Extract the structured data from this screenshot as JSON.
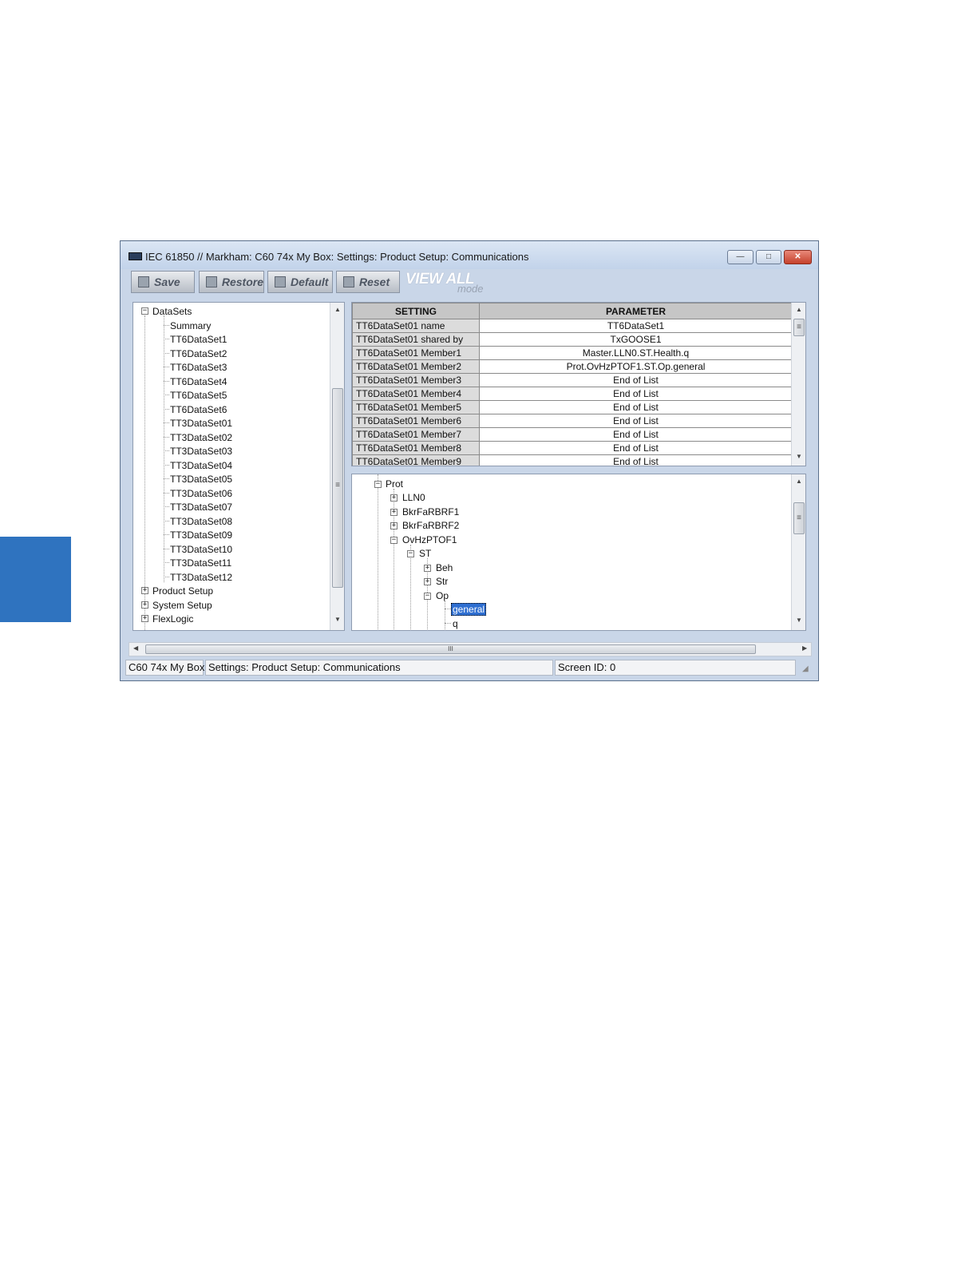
{
  "window": {
    "title": "IEC 61850 // Markham: C60 74x My Box: Settings: Product Setup: Communications",
    "minimize": "—",
    "restore": "□",
    "close": "✕"
  },
  "toolbar": {
    "save_label": "Save",
    "restore_label": "Restore",
    "default_label": "Default",
    "reset_label": "Reset",
    "view_all_label": "VIEW ALL",
    "mode_label": "mode"
  },
  "left_tree": {
    "root": "DataSets",
    "children": [
      "Summary",
      "TT6DataSet1",
      "TT6DataSet2",
      "TT6DataSet3",
      "TT6DataSet4",
      "TT6DataSet5",
      "TT6DataSet6",
      "TT3DataSet01",
      "TT3DataSet02",
      "TT3DataSet03",
      "TT3DataSet04",
      "TT3DataSet05",
      "TT3DataSet06",
      "TT3DataSet07",
      "TT3DataSet08",
      "TT3DataSet09",
      "TT3DataSet10",
      "TT3DataSet11",
      "TT3DataSet12"
    ],
    "siblings": [
      "Product Setup",
      "System Setup",
      "FlexLogic"
    ]
  },
  "grid": {
    "headers": [
      "SETTING",
      "PARAMETER"
    ],
    "rows": [
      [
        "TT6DataSet01 name",
        "TT6DataSet1"
      ],
      [
        "TT6DataSet01 shared by",
        "TxGOOSE1"
      ],
      [
        "TT6DataSet01 Member1",
        "Master.LLN0.ST.Health.q"
      ],
      [
        "TT6DataSet01 Member2",
        "Prot.OvHzPTOF1.ST.Op.general"
      ],
      [
        "TT6DataSet01 Member3",
        "End of List"
      ],
      [
        "TT6DataSet01 Member4",
        "End of List"
      ],
      [
        "TT6DataSet01 Member5",
        "End of List"
      ],
      [
        "TT6DataSet01 Member6",
        "End of List"
      ],
      [
        "TT6DataSet01 Member7",
        "End of List"
      ],
      [
        "TT6DataSet01 Member8",
        "End of List"
      ],
      [
        "TT6DataSet01 Member9",
        "End of List"
      ]
    ]
  },
  "object_tree": {
    "prot": "Prot",
    "lln0": "LLN0",
    "bkr1": "BkrFaRBRF1",
    "bkr2": "BkrFaRBRF2",
    "ovhz": "OvHzPTOF1",
    "st": "ST",
    "beh": "Beh",
    "str": "Str",
    "op": "Op",
    "general": "general",
    "q": "q"
  },
  "scroll": {
    "h_grip": "III",
    "v_grip": "≡"
  },
  "status": {
    "device": "C60 74x My Box",
    "path": "Settings: Product Setup: Communications",
    "screen": "Screen ID: 0"
  }
}
